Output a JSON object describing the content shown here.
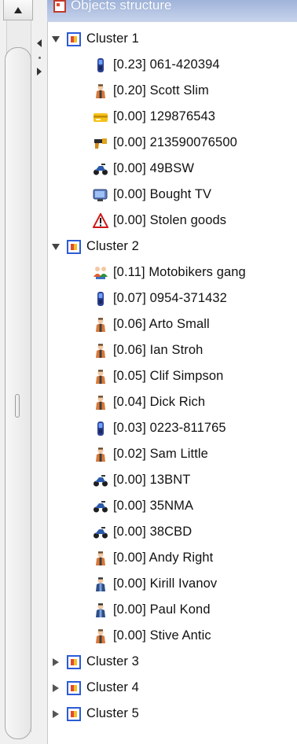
{
  "header": {
    "title": "Objects structure"
  },
  "clusters": [
    {
      "label": "Cluster 1",
      "expanded": true,
      "items": [
        {
          "label": "[0.23] 061-420394",
          "icon": "phone-icon"
        },
        {
          "label": "[0.20] Scott Slim",
          "icon": "person-icon"
        },
        {
          "label": "[0.00] 129876543",
          "icon": "card-icon"
        },
        {
          "label": "[0.00] 213590076500",
          "icon": "gun-icon"
        },
        {
          "label": "[0.00] 49BSW",
          "icon": "motorbike-icon"
        },
        {
          "label": "[0.00] Bought TV",
          "icon": "tv-icon"
        },
        {
          "label": "[0.00] Stolen goods",
          "icon": "warning-icon"
        }
      ]
    },
    {
      "label": "Cluster 2",
      "expanded": true,
      "items": [
        {
          "label": "[0.11] Motobikers gang",
          "icon": "group-icon"
        },
        {
          "label": "[0.07] 0954-371432",
          "icon": "phone-icon"
        },
        {
          "label": "[0.06] Arto Small",
          "icon": "person-icon"
        },
        {
          "label": "[0.06] Ian Stroh",
          "icon": "person-icon"
        },
        {
          "label": "[0.05] Clif Simpson",
          "icon": "person-icon"
        },
        {
          "label": "[0.04] Dick Rich",
          "icon": "person-icon"
        },
        {
          "label": "[0.03] 0223-811765",
          "icon": "phone-icon"
        },
        {
          "label": "[0.02] Sam Little",
          "icon": "person-icon"
        },
        {
          "label": "[0.00] 13BNT",
          "icon": "motorbike-icon"
        },
        {
          "label": "[0.00] 35NMA",
          "icon": "motorbike-icon"
        },
        {
          "label": "[0.00] 38CBD",
          "icon": "motorbike-icon"
        },
        {
          "label": "[0.00] Andy Right",
          "icon": "person-icon"
        },
        {
          "label": "[0.00] Kirill Ivanov",
          "icon": "person-blue-icon"
        },
        {
          "label": "[0.00] Paul Kond",
          "icon": "person-blue-icon"
        },
        {
          "label": "[0.00] Stive Antic",
          "icon": "person-icon"
        }
      ]
    },
    {
      "label": "Cluster 3",
      "expanded": false,
      "items": []
    },
    {
      "label": "Cluster 4",
      "expanded": false,
      "items": []
    },
    {
      "label": "Cluster 5",
      "expanded": false,
      "items": []
    }
  ]
}
